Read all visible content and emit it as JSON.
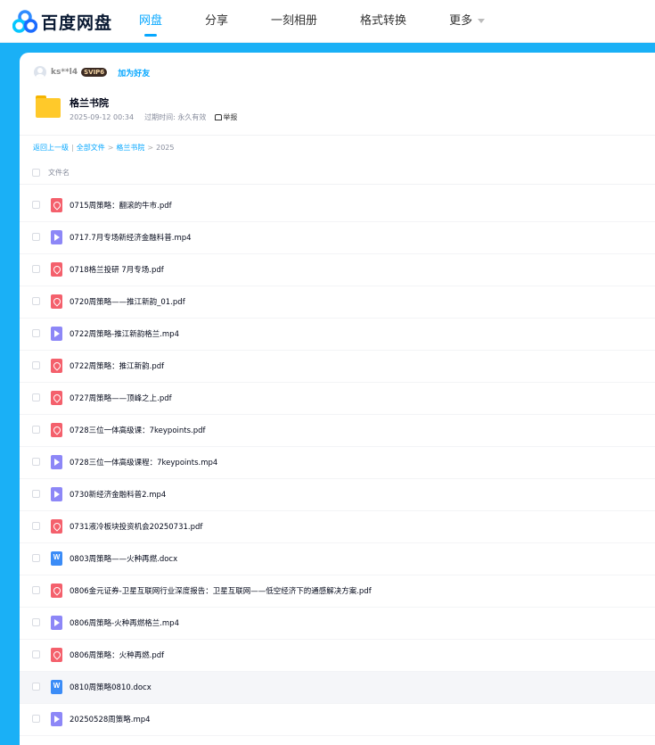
{
  "header": {
    "logo_text": "百度网盘",
    "nav": [
      "网盘",
      "分享",
      "一刻相册",
      "格式转换",
      "更多"
    ]
  },
  "colors": {
    "accent": "#06a7ff",
    "background": "#1ab0f6",
    "pdf": "#f4606c",
    "video": "#8d87f7",
    "word": "#3b8cf7"
  },
  "share": {
    "sharer_name": "ks**l4",
    "badge": "SVIP6",
    "add_friend": "加为好友",
    "title": "格兰书院",
    "date": "2025-09-12 00:34",
    "expiry_label": "过期时间: 永久有效",
    "report": "举报"
  },
  "breadcrumb": {
    "back": "返回上一级",
    "all": "全部文件",
    "folder": "格兰书院",
    "current": "2025"
  },
  "list": {
    "column_header": "文件名",
    "files": [
      {
        "name": "0715周策略：翻滚的牛市.pdf",
        "icon": "pdf-icon"
      },
      {
        "name": "0717.7月专场新经济金融科普.mp4",
        "icon": "video-icon"
      },
      {
        "name": "0718格兰投研 7月专场.pdf",
        "icon": "pdf-icon"
      },
      {
        "name": "0720周策略——推江新韵_01.pdf",
        "icon": "pdf-icon"
      },
      {
        "name": "0722周策略-推江新韵格兰.mp4",
        "icon": "video-icon"
      },
      {
        "name": "0722周策略：推江新韵.pdf",
        "icon": "pdf-icon"
      },
      {
        "name": "0727周策略——顶峰之上.pdf",
        "icon": "pdf-icon"
      },
      {
        "name": "0728三位一体高级课：7keypoints.pdf",
        "icon": "pdf-icon"
      },
      {
        "name": "0728三位一体高级课程：7keypoints.mp4",
        "icon": "video-icon"
      },
      {
        "name": "0730新经济金融科普2.mp4",
        "icon": "video-icon"
      },
      {
        "name": "0731液冷板块投资机会20250731.pdf",
        "icon": "pdf-icon"
      },
      {
        "name": "0803周策略——火种再燃.docx",
        "icon": "word-icon"
      },
      {
        "name": "0806金元证券-卫星互联网行业深度报告：卫星互联网——低空经济下的通感解决方案.pdf",
        "icon": "pdf-icon"
      },
      {
        "name": "0806周策略-火种再燃格兰.mp4",
        "icon": "video-icon"
      },
      {
        "name": "0806周策略：火种再燃.pdf",
        "icon": "pdf-icon"
      },
      {
        "name": "0810周策略0810.docx",
        "icon": "word-icon"
      },
      {
        "name": "20250528周策略.mp4",
        "icon": "video-icon"
      }
    ]
  }
}
